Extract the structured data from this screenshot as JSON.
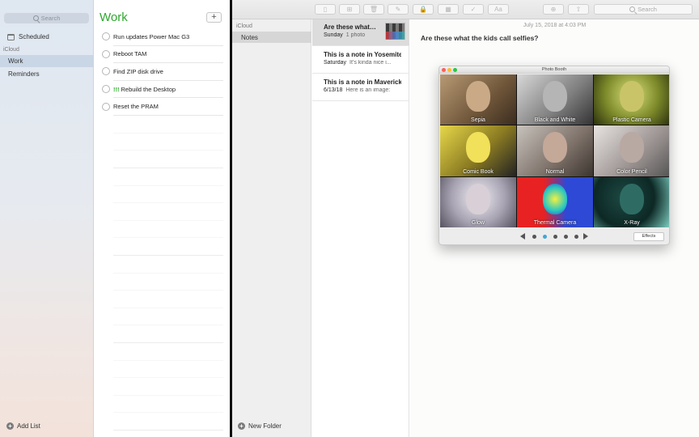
{
  "reminders": {
    "search_placeholder": "Search",
    "scheduled_label": "Scheduled",
    "account_heading": "iCloud",
    "lists": [
      {
        "label": "Work",
        "selected": true
      },
      {
        "label": "Reminders",
        "selected": false
      }
    ],
    "add_list_label": "Add List",
    "current_list": {
      "title": "Work",
      "add_label": "+",
      "accent_color": "#2ea82e",
      "items": [
        {
          "label": "Run updates Power Mac G3",
          "priority": ""
        },
        {
          "label": "Reboot TAM",
          "priority": ""
        },
        {
          "label": "Find ZIP disk drive",
          "priority": ""
        },
        {
          "label": "Rebuild the Desktop",
          "priority": "!!!"
        },
        {
          "label": "Reset the PRAM",
          "priority": ""
        }
      ]
    }
  },
  "notes": {
    "toolbar": {
      "search_placeholder": "Search",
      "buttons": [
        {
          "name": "sidebar-toggle",
          "icon": "sidebar-icon",
          "glyph": "▯"
        },
        {
          "name": "gallery-view",
          "icon": "grid-icon",
          "glyph": "⊞"
        },
        {
          "name": "delete",
          "icon": "trash-icon",
          "glyph": "🗑"
        },
        {
          "name": "compose",
          "icon": "compose-icon",
          "glyph": "✎"
        },
        {
          "name": "lock",
          "icon": "lock-icon",
          "glyph": "🔒"
        },
        {
          "name": "table",
          "icon": "table-icon",
          "glyph": "▦"
        },
        {
          "name": "checklist",
          "icon": "checklist-icon",
          "glyph": "✓"
        },
        {
          "name": "format",
          "icon": "format-icon",
          "glyph": "Aa"
        },
        {
          "name": "add-people",
          "icon": "people-icon",
          "glyph": "⊕"
        },
        {
          "name": "share",
          "icon": "share-icon",
          "glyph": "⇧"
        }
      ]
    },
    "sidebar": {
      "account_heading": "iCloud",
      "folders": [
        {
          "label": "Notes",
          "selected": true
        }
      ],
      "new_folder_label": "New Folder"
    },
    "list": [
      {
        "title": "Are these what the kids call selfies?",
        "date": "Sunday",
        "snippet": "1 photo",
        "selected": true,
        "has_thumbnail": true
      },
      {
        "title": "This is a note in Yosemite",
        "date": "Saturday",
        "snippet": "It’s kinda nice i...",
        "selected": false,
        "has_thumbnail": false
      },
      {
        "title": "This is a note in Mavericks",
        "date": "6/13/18",
        "snippet": "Here is an image:",
        "selected": false,
        "has_thumbnail": false
      }
    ],
    "editor": {
      "date": "July 15, 2018 at 4:03 PM",
      "heading": "Are these what the kids call selfies?"
    }
  },
  "photo_booth": {
    "title": "Photo Booth",
    "effects_button": "Effects",
    "effects": [
      {
        "label": "Sepia"
      },
      {
        "label": "Black and White"
      },
      {
        "label": "Plastic Camera"
      },
      {
        "label": "Comic Book"
      },
      {
        "label": "Normal"
      },
      {
        "label": "Color Pencil"
      },
      {
        "label": "Glow"
      },
      {
        "label": "Thermal Camera"
      },
      {
        "label": "X-Ray"
      }
    ],
    "page_count": 5,
    "current_page": 1
  }
}
